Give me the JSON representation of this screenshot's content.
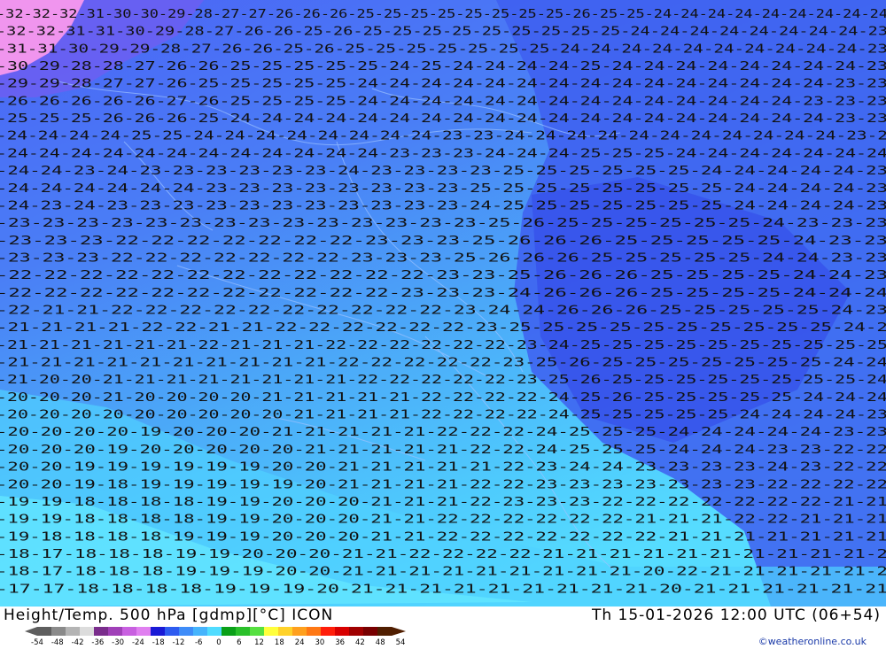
{
  "header": {
    "title_left": "Height/Temp. 500 hPa [gdmp][°C] ICON",
    "title_right": "Th 15-01-2026 12:00 UTC (06+54)",
    "credit": "©weatheronline.co.uk"
  },
  "colors": {
    "pink": "#ff9ef0",
    "purple_blue": "#5a5af5",
    "blue_deep": "#3d5ef0",
    "blue_mid": "#4a82f5",
    "blue_light": "#4fa8f8",
    "cyan": "#4ed2ff",
    "cyan_light": "#5ee0ff"
  },
  "legend": {
    "ticks": [
      "-54",
      "-48",
      "-42",
      "-36",
      "-30",
      "-24",
      "-18",
      "-12",
      "-6",
      "0",
      "6",
      "12",
      "18",
      "24",
      "30",
      "36",
      "42",
      "48",
      "54"
    ],
    "colors": [
      "#5e5e5e",
      "#8a8a8a",
      "#b4b4b4",
      "#dcdcdc",
      "#7a2d8c",
      "#a040b8",
      "#c860e0",
      "#e080f0",
      "#1a1ad6",
      "#2e5cf0",
      "#3e8cf8",
      "#46b4fc",
      "#50dcff",
      "#0aa018",
      "#2ac02a",
      "#56e040",
      "#ffff3c",
      "#ffd22a",
      "#ffa01e",
      "#ff7814",
      "#ff1e0a",
      "#d80000",
      "#a00000",
      "#780000",
      "#501e00"
    ]
  },
  "map": {
    "label_rows": [
      {
        "text": "-32-32-32-31-30-30-29-28-27-27-26-26-26-25-25-25-25-25-25-25-25-26-25-25-24-24-24-24-24-24-24-24-24"
      },
      {
        "text": "-32-32-31-31-30-29-28-27-26-26-25-26-25-25-25-25-25-25-25-25-25-24-24-24-24-24-24-24-24-23"
      },
      {
        "text": "-31-31-30-29-29-28-27-26-26-25-26-25-25-25-25-25-25-25-24-24-24-24-24-24-24-24-24-24-23"
      },
      {
        "text": "-30-29-28-28-27-26-26-25-25-25-25-25-24-25-24-24-24-24-25-24-24-24-24-24-24-24-24-23"
      },
      {
        "text": "-29-29-28-27-27-26-25-25-25-25-25-24-24-24-24-24-24-24-24-24-24-24-24-24-24-24-23-23"
      },
      {
        "text": "-26-26-26-26-26-27-26-25-25-25-25-24-24-24-24-24-24-24-24-24-24-24-24-24-24-23-23-23"
      },
      {
        "text": "-25-25-25-26-26-26-25-24-24-24-24-24-24-24-24-24-24-24-24-24-24-24-24-24-24-24-23-23"
      },
      {
        "text": "-24-24-24-24-25-25-24-24-24-24-24-24-24-24-23-23-24-24-24-24-24-24-24-24-24-24-24-23-2"
      },
      {
        "text": "-24-24-24-24-24-24-24-24-24-24-24-24-23-23-23-24-24-24-25-25-25-24-24-24-24-24-24-24"
      },
      {
        "text": "-24-24-23-24-23-23-23-23-23-23-24-23-23-23-23-25-25-25-25-25-25-24-24-24-24-24-23"
      },
      {
        "text": "-24-24-24-24-24-24-23-23-23-23-23-23-23-23-25-25-25-25-25-25-25-25-24-24-24-24-23"
      },
      {
        "text": "-24-23-24-23-23-23-23-23-23-23-23-23-23-23-24-25-25-25-25-25-25-25-24-24-24-24-23"
      },
      {
        "text": "-23-23-23-23-23-23-23-23-23-23-23-23-23-23-25-26-25-25-25-25-25-25-24-23-23-23"
      },
      {
        "text": "-23-23-23-22-22-22-22-22-22-22-23-23-23-25-26-26-26-25-25-25-25-25-24-23-23"
      },
      {
        "text": "-23-23-23-22-22-22-22-22-22-22-23-23-23-25-26-26-26-25-25-25-25-25-24-24-23-23"
      },
      {
        "text": "-22-22-22-22-22-22-22-22-22-22-22-22-23-23-25-26-26-26-25-25-25-25-24-24-23"
      },
      {
        "text": "-22-22-22-22-22-22-22-22-22-22-22-23-23-23-24-26-26-26-25-25-25-25-24-24-24"
      },
      {
        "text": "-22-21-21-22-22-22-22-22-22-22-22-22-22-23-24-24-26-26-26-25-25-25-25-25-24-23"
      },
      {
        "text": "-21-21-21-21-22-22-21-21-22-22-22-22-22-22-23-25-25-25-25-25-25-25-25-25-25-24-2"
      },
      {
        "text": "-21-21-21-21-21-21-22-21-21-21-22-22-22-22-22-22-23-24-25-25-25-25-25-25-25-25-25-25"
      },
      {
        "text": "-21-21-21-21-21-21-21-21-21-21-22-22-22-22-22-23-25-26-25-25-25-25-25-25-25-24-24"
      },
      {
        "text": "-21-20-20-21-21-21-21-21-21-21-21-22-22-22-22-22-23-25-26-25-25-25-25-25-25-25-25-24"
      },
      {
        "text": "-20-20-20-21-20-20-20-20-21-21-21-21-21-22-22-22-22-24-25-26-25-25-25-25-25-24-24-24"
      },
      {
        "text": "-20-20-20-20-20-20-20-20-20-21-21-21-21-22-22-22-22-24-25-25-25-25-25-24-24-24-24-23"
      },
      {
        "text": "-20-20-20-20-19-20-20-20-21-21-21-21-21-22-22-22-24-25-25-25-24-24-24-24-24-23-23"
      },
      {
        "text": "-20-20-20-19-20-20-20-20-20-21-21-21-21-21-22-22-24-25-25-25-24-24-24-23-23-22-22"
      },
      {
        "text": "-20-20-19-19-19-19-19-19-20-20-21-21-21-21-21-22-23-24-24-23-23-23-23-24-23-22-22"
      },
      {
        "text": "-20-20-19-18-19-19-19-19-19-20-21-21-21-21-22-22-23-23-23-23-23-23-23-22-22-22-22"
      },
      {
        "text": "-19-19-18-18-18-18-19-19-20-20-20-21-21-21-22-23-23-23-22-22-22-22-22-22-22-21-21"
      },
      {
        "text": "-19-19-18-18-18-18-19-19-20-20-20-21-21-22-22-22-22-22-22-21-21-21-22-22-21-21-21"
      },
      {
        "text": "-19-18-18-18-18-19-19-19-20-20-20-21-21-22-22-22-22-22-22-22-21-21-21-21-21-21-21"
      },
      {
        "text": "-18-17-18-18-18-19-19-20-20-20-21-21-22-22-22-22-21-21-21-21-21-21-21-21-21-21-2"
      },
      {
        "text": "-18-17-18-18-18-19-19-19-20-20-21-21-21-21-21-21-21-21-21-20-22-21-21-21-21-21-2"
      },
      {
        "text": "-17-17-18-18-18-18-19-19-19-20-21-21-21-21-21-21-21-21-21-20-21-21-21-21-21-21"
      }
    ]
  }
}
